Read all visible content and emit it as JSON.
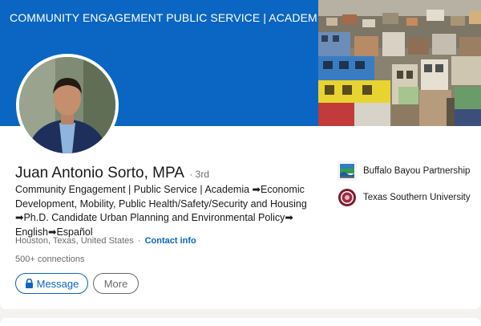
{
  "banner": {
    "text": "COMMUNITY ENGAGEMENT PUBLIC SERVICE | ACADEMIA"
  },
  "profile": {
    "name": "Juan Antonio Sorto, MPA",
    "degree": "· 3rd",
    "headline": "Community Engagement | Public Service | Academia ➡Economic Development, Mobility, Public Health/Safety/Security and Housing ➡Ph.D. Candidate Urban Planning and Environmental Policy➡ English➡Español",
    "location": "Houston, Texas, United States",
    "separator": "·",
    "contact_label": "Contact info",
    "connections": "500+ connections"
  },
  "actions": {
    "message_label": "Message",
    "more_label": "More"
  },
  "organizations": [
    {
      "name": "Buffalo Bayou Partnership",
      "icon": "buffalo-bayou-logo"
    },
    {
      "name": "Texas Southern University",
      "icon": "tsu-seal-logo"
    }
  ],
  "colors": {
    "accent": "#0a66c2",
    "banner_bg": "#0a66c2",
    "tsu_maroon": "#7b1c2e"
  }
}
